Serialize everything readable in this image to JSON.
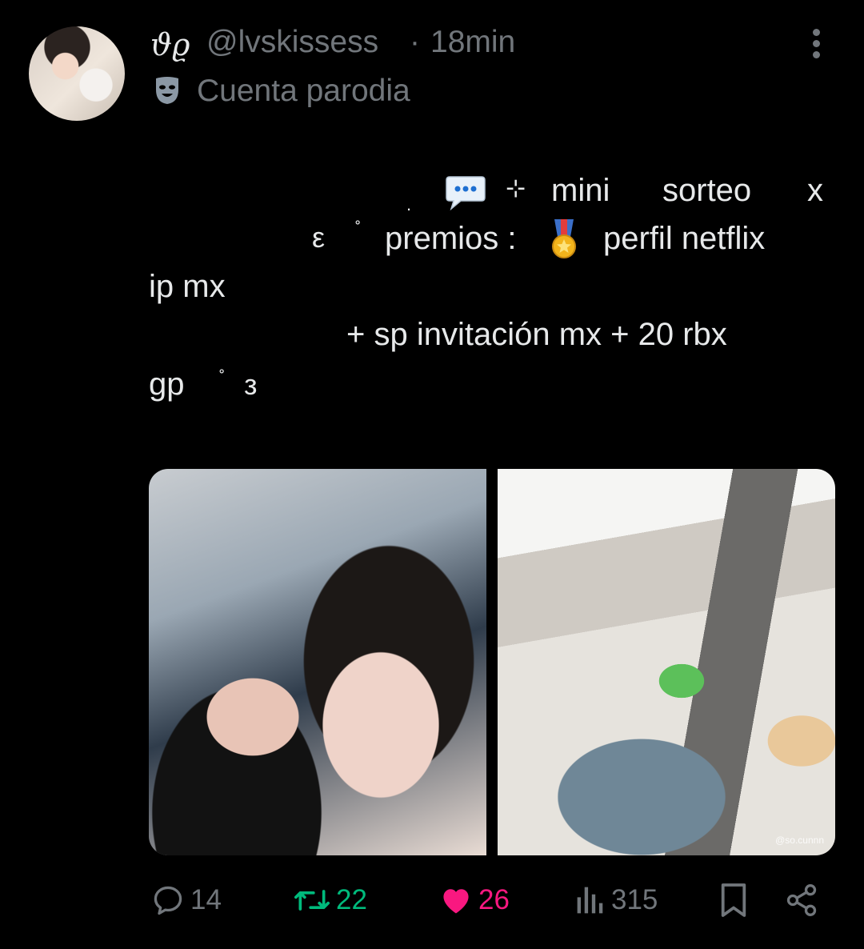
{
  "tweet": {
    "display_name": "𝜗𝜚",
    "handle": "@lvskissess",
    "separator": "·",
    "time": "18min",
    "badge_label": "Cuenta parodia",
    "text": {
      "line1_dot": ".",
      "line1_sparkle": "⊹",
      "line1_mini": "mini",
      "line1_sorteo": "sorteo",
      "line1_x": "x",
      "line2_open": "ε",
      "line2_ring": "˚",
      "line2_premios": "premios :",
      "line2_perfil": "perfil netflix",
      "line3": "ip mx",
      "line4": "+ sp invitación mx + 20 rbx",
      "line5_gp": "gp",
      "line5_ring": "˚",
      "line5_close": "з"
    },
    "media": [
      {
        "icon": "portrait-photo"
      },
      {
        "icon": "food-postcards-photo",
        "watermark": "@so.cunnn"
      }
    ],
    "actions": {
      "replies": "14",
      "retweets": "22",
      "likes": "26",
      "views": "315"
    }
  },
  "colors": {
    "background": "#000000",
    "text": "#e7e9ea",
    "muted": "#71767b",
    "retweet": "#00ba7c",
    "like": "#f91880"
  }
}
